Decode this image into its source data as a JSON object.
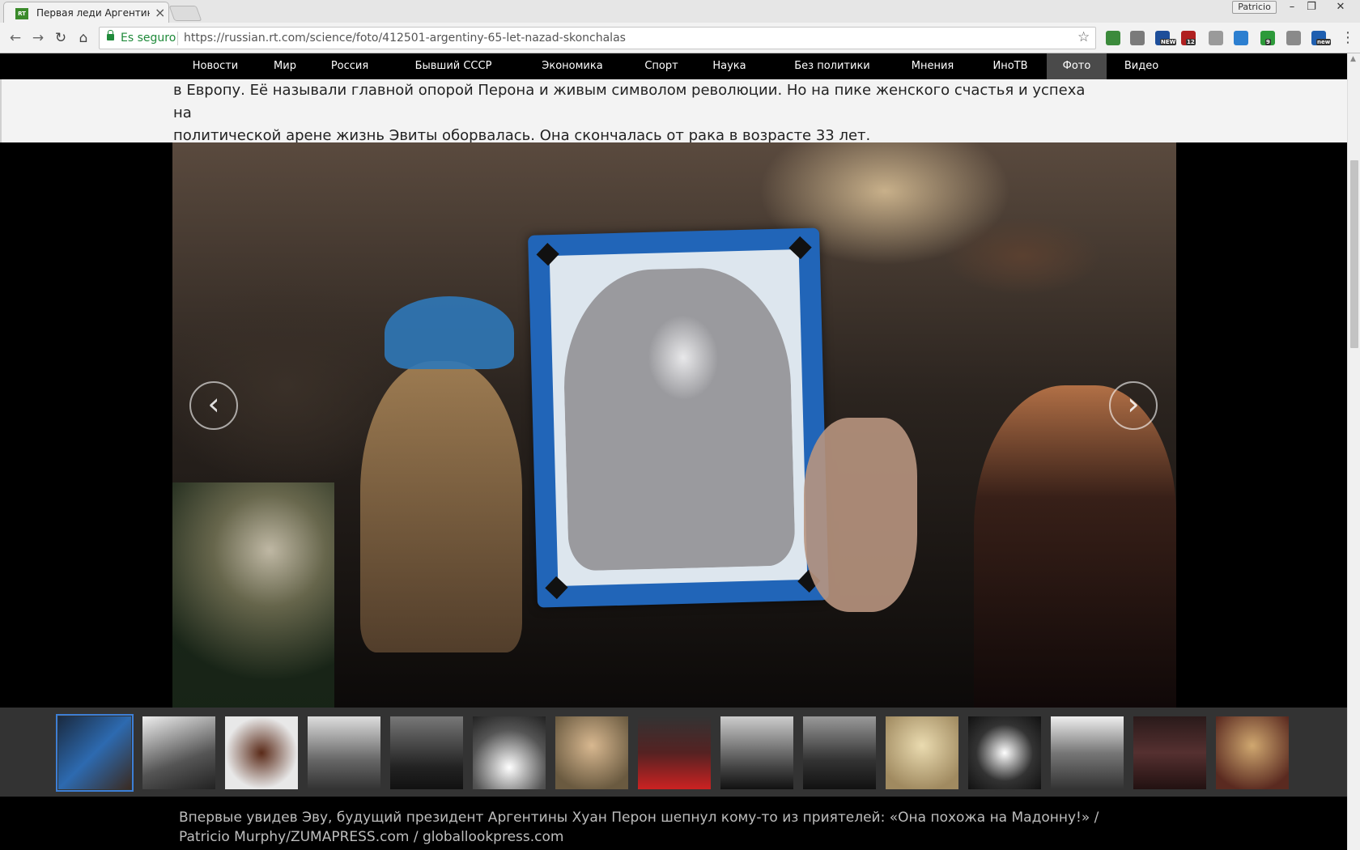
{
  "browser": {
    "tab_title": "Первая леди Аргентины",
    "tab_favicon": "RT",
    "profile_name": "Patricio",
    "secure_label": "Es seguro",
    "url": "https://russian.rt.com/science/foto/412501-argentiny-65-let-nazad-skonchalas",
    "extensions": [
      {
        "icon": "puzzle-icon",
        "color": "#3b8a3b",
        "badge": ""
      },
      {
        "icon": "refresh-circle-icon",
        "color": "#7a7a7a",
        "badge": ""
      },
      {
        "icon": "news-icon",
        "color": "#1d4e9a",
        "badge": "NEW"
      },
      {
        "icon": "ublock-icon",
        "color": "#b02020",
        "badge": "12"
      },
      {
        "icon": "camera-icon",
        "color": "#9a9a9a",
        "badge": ""
      },
      {
        "icon": "screenshot-icon",
        "color": "#2c7fd0",
        "badge": ""
      },
      {
        "icon": "download-icon",
        "color": "#2d9a3a",
        "badge": "9"
      },
      {
        "icon": "facebook-icon",
        "color": "#8a8a8a",
        "badge": ""
      },
      {
        "icon": "mail-icon",
        "color": "#1f5fb0",
        "badge": "new"
      }
    ]
  },
  "site_nav": {
    "items": [
      {
        "label": "Новости",
        "active": false
      },
      {
        "label": "Мир",
        "active": false
      },
      {
        "label": "Россия",
        "active": false
      },
      {
        "label": "Бывший СССР",
        "active": false
      },
      {
        "label": "Экономика",
        "active": false
      },
      {
        "label": "Спорт",
        "active": false
      },
      {
        "label": "Наука",
        "active": false
      },
      {
        "label": "Без политики",
        "active": false
      },
      {
        "label": "Мнения",
        "active": false
      },
      {
        "label": "ИноТВ",
        "active": false
      },
      {
        "label": "Фото",
        "active": true
      },
      {
        "label": "Видео",
        "active": false
      }
    ]
  },
  "article": {
    "text_line1": "в Европу. Её называли главной опорой Перона и живым символом революции. Но на пике женского счастья и успеха на",
    "text_line2": "политической арене жизнь Эвиты оборвалась. Она скончалась от рака в возрасте 33 лет."
  },
  "gallery": {
    "prev_glyph": "‹",
    "next_glyph": "›",
    "thumbnail_count": 15,
    "active_thumbnail": 1,
    "caption": "Впервые увидев Эву, будущий президент Аргентины Хуан Перон шепнул кому-то из приятелей: «Она похожа на Мадонну!» / Patricio Murphy/ZUMAPRESS.com / globallookpress.com"
  }
}
